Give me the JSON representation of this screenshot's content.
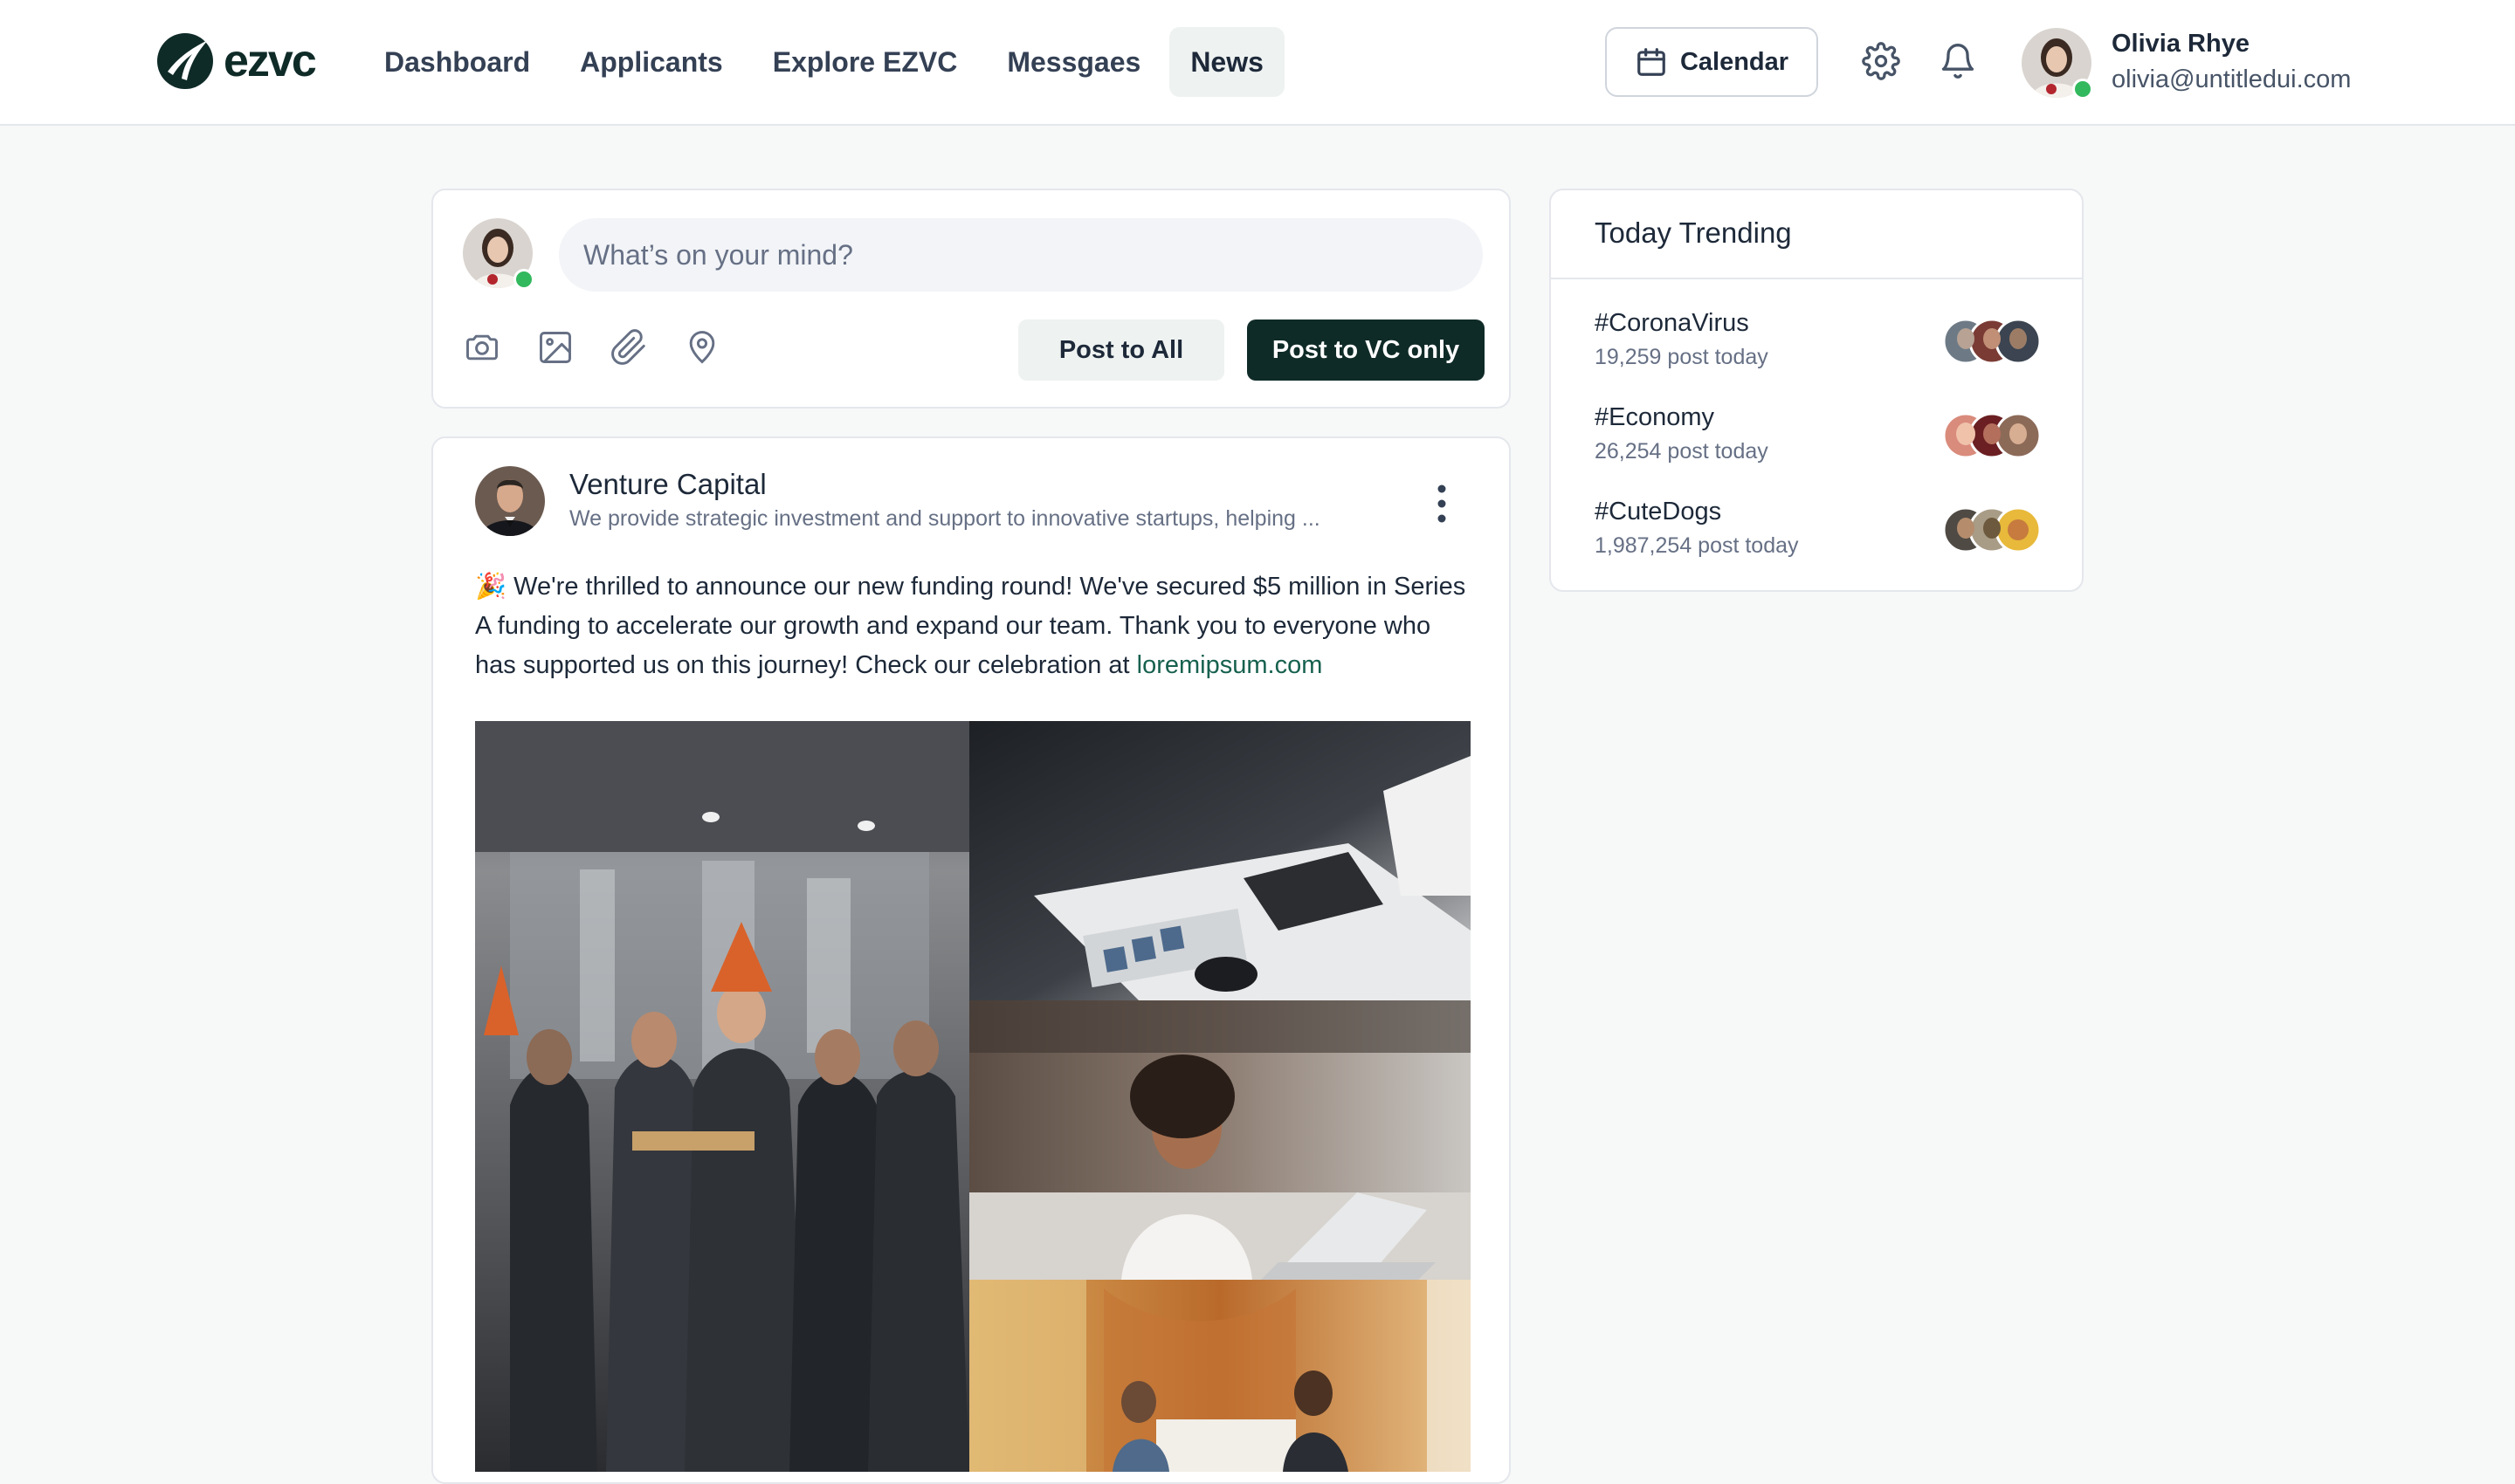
{
  "brand": {
    "name": "ezvc"
  },
  "nav": [
    {
      "label": "Dashboard",
      "active": false
    },
    {
      "label": "Applicants",
      "active": false
    },
    {
      "label": "Explore EZVC",
      "active": false
    },
    {
      "label": "Messgaes",
      "active": false
    },
    {
      "label": "News",
      "active": true
    }
  ],
  "header": {
    "calendar_label": "Calendar",
    "user": {
      "name": "Olivia Rhye",
      "email": "olivia@untitledui.com"
    }
  },
  "composer": {
    "placeholder": "What’s on your mind?",
    "tools": [
      "camera-icon",
      "image-icon",
      "attachment-icon",
      "location-icon"
    ],
    "post_all_label": "Post to All",
    "post_vc_label": "Post to VC only"
  },
  "post": {
    "author": "Venture Capital",
    "description": "We provide strategic investment and support to innovative startups, helping ...",
    "emoji": "🎉",
    "text": "We're thrilled to announce our new funding round! We've secured $5 million in Series A funding to accelerate our growth and expand our team. Thank you to everyone who has supported us on this journey! Check our celebration at ",
    "link": "loremipsum.com"
  },
  "trending": {
    "title": "Today Trending",
    "items": [
      {
        "tag": "#CoronaVirus",
        "count": "19,259 post today"
      },
      {
        "tag": "#Economy",
        "count": "26,254 post today"
      },
      {
        "tag": "#CuteDogs",
        "count": "1,987,254 post today"
      }
    ]
  },
  "colors": {
    "brand": "#0f2b28",
    "accent_link": "#17614f",
    "online": "#32b85d",
    "page_bg": "#f7f8f8"
  }
}
